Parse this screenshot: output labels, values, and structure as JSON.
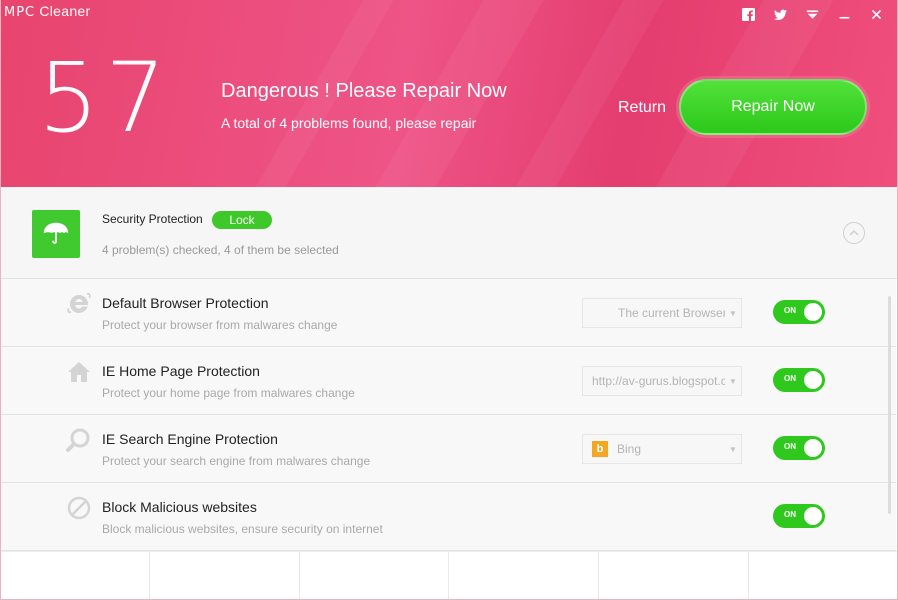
{
  "app": {
    "logo": "MPC",
    "name": "Cleaner"
  },
  "titlebar": {
    "icons": [
      "facebook-icon",
      "twitter-icon",
      "menu-icon",
      "minimize-icon",
      "close-icon"
    ]
  },
  "header": {
    "score": "57",
    "title": "Dangerous ! Please Repair Now",
    "subtitle": "A total of 4 problems found, please repair",
    "return_label": "Return",
    "repair_label": "Repair Now"
  },
  "section": {
    "title": "Security Protection",
    "badge": "Lock",
    "subtitle": "4 problem(s) checked, 4 of them be selected"
  },
  "items": [
    {
      "title": "Default Browser Protection",
      "subtitle": "Protect your browser from malwares change",
      "dropdown": "The current Browser",
      "toggle": "ON",
      "icon": "ie-icon"
    },
    {
      "title": "IE Home Page Protection",
      "subtitle": "Protect your home page from malwares change",
      "dropdown": "http://av-gurus.blogspot.com",
      "toggle": "ON",
      "icon": "home-icon"
    },
    {
      "title": "IE Search Engine Protection",
      "subtitle": "Protect your search engine from malwares change",
      "dropdown": "Bing",
      "toggle": "ON",
      "icon": "search-icon"
    },
    {
      "title": "Block Malicious websites",
      "subtitle": "Block malicious websites, ensure security on internet",
      "toggle": "ON",
      "icon": "block-icon"
    }
  ],
  "colors": {
    "header": "#ee5487",
    "accent_green": "#3fc82a"
  }
}
